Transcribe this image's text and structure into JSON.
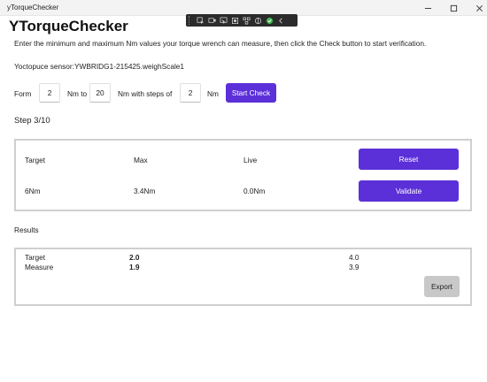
{
  "window": {
    "title": "yTorqueChecker"
  },
  "debug_toolbar": {
    "icons": [
      "select-element-icon",
      "live-visual-tree-icon",
      "display-layout-adorners-icon",
      "track-focused-element-icon",
      "binding-failures-icon",
      "hot-reload-icon",
      "hot-reload-status-icon",
      "collapse-icon"
    ]
  },
  "app": {
    "heading": "YTorqueChecker",
    "instructions": "Enter the minimum and maximum Nm values your torque wrench can measure, then click the Check button to start verification.",
    "sensor_text": "Yoctopuce sensor:YWBRIDG1-215425.weighScale1"
  },
  "range": {
    "from_label": "Form",
    "from_value": "2",
    "to_label": "Nm to",
    "to_value": "20",
    "steps_label": "Nm with steps of",
    "steps_value": "2",
    "unit_label": "Nm",
    "start_button": "Start Check"
  },
  "step": {
    "text": "Step 3/10"
  },
  "check_panel": {
    "target_header": "Target",
    "max_header": "Max",
    "live_header": "Live",
    "target_value": "6Nm",
    "max_value": "3.4Nm",
    "live_value": "0.0Nm",
    "reset_button": "Reset",
    "validate_button": "Validate"
  },
  "results": {
    "label": "Results",
    "row_labels": [
      "Target",
      "Measure"
    ],
    "columns": [
      {
        "target": "2.0",
        "measure": "1.9",
        "bold": true
      },
      {
        "target": "4.0",
        "measure": "3.9",
        "bold": false
      }
    ],
    "export_button": "Export"
  },
  "colors": {
    "accent": "#5c30d9",
    "export_button": "#c8c8c8",
    "panel_border": "#cfcfcf"
  }
}
